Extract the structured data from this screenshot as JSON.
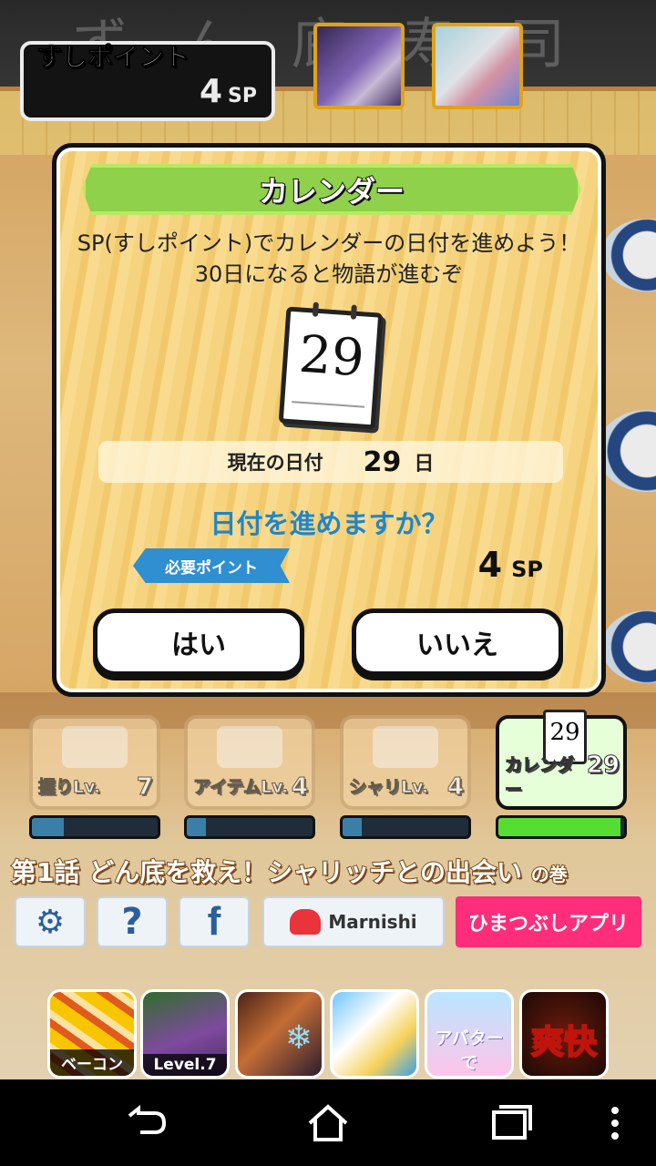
{
  "hud": {
    "sp_title": "すしポイント",
    "sp_value": "4",
    "sp_unit": "SP"
  },
  "dialog": {
    "title": "カレンダー",
    "message_line1": "SP(すしポイント)でカレンダーの日付を進めよう！",
    "message_line2": "30日になると物語が進むぞ",
    "calendar_day": "29",
    "date_label": "現在の日付",
    "date_value": "29",
    "date_unit": "日",
    "question": "日付を進めますか？",
    "required_label": "必要ポイント",
    "required_value": "4",
    "required_unit": "SP",
    "yes_label": "はい",
    "no_label": "いいえ"
  },
  "upgrades": [
    {
      "label": "握りLv.",
      "level": "7",
      "progress": 0.25
    },
    {
      "label": "アイテムLv.",
      "level": "4",
      "progress": 0.15
    },
    {
      "label": "シャリLv.",
      "level": "4",
      "progress": 0.15
    },
    {
      "label": "カレンダー",
      "level": "29",
      "calendar_day": "29",
      "progress": 0.97
    }
  ],
  "episode": {
    "text": "第1話 どん底を救え！シャリッチとの出会い",
    "suffix": "の巻"
  },
  "toolbar": {
    "marnishi_label": "Marnishi",
    "hima_label": "ひまつぶしアプリ"
  },
  "apps": [
    {
      "caption": "ベーコン"
    },
    {
      "caption": "Level.7"
    },
    {
      "caption": ""
    },
    {
      "caption": ""
    },
    {
      "caption": "アバターで"
    },
    {
      "caption": "爽快"
    }
  ],
  "colors": {
    "title_green": "#8fd14b",
    "question_blue": "#1f86c9",
    "hima_pink": "#ff2d7a",
    "calendar_bar_green": "#55dd33"
  }
}
